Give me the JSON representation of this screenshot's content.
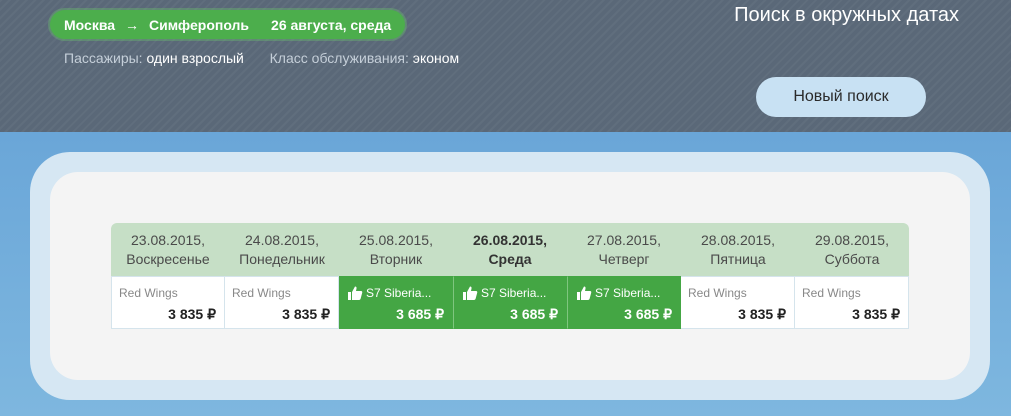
{
  "header": {
    "route_from": "Москва",
    "route_arrow": "→",
    "route_to": "Симферополь",
    "route_date": "26 августа, среда",
    "passengers_label": "Пассажиры:",
    "passengers_value": "один взрослый",
    "class_label": "Класс обслуживания:",
    "class_value": "эконом",
    "title": "Поиск в окружных датах",
    "new_search_label": "Новый поиск"
  },
  "days": [
    {
      "date": "23.08.2015,",
      "weekday": "Воскресенье",
      "current": false
    },
    {
      "date": "24.08.2015,",
      "weekday": "Понедельник",
      "current": false
    },
    {
      "date": "25.08.2015,",
      "weekday": "Вторник",
      "current": false
    },
    {
      "date": "26.08.2015,",
      "weekday": "Среда",
      "current": true
    },
    {
      "date": "27.08.2015,",
      "weekday": "Четверг",
      "current": false
    },
    {
      "date": "28.08.2015,",
      "weekday": "Пятница",
      "current": false
    },
    {
      "date": "29.08.2015,",
      "weekday": "Суббота",
      "current": false
    }
  ],
  "fares": [
    {
      "airline": "Red Wings",
      "price": "3 835 ₽",
      "best": false
    },
    {
      "airline": "Red Wings",
      "price": "3 835 ₽",
      "best": false
    },
    {
      "airline": "S7 Siberia...",
      "price": "3 685 ₽",
      "best": true,
      "icon": "thumbs-up-icon"
    },
    {
      "airline": "S7 Siberia...",
      "price": "3 685 ₽",
      "best": true,
      "icon": "thumbs-up-icon"
    },
    {
      "airline": "S7 Siberia...",
      "price": "3 685 ₽",
      "best": true,
      "icon": "thumbs-up-icon"
    },
    {
      "airline": "Red Wings",
      "price": "3 835 ₽",
      "best": false
    },
    {
      "airline": "Red Wings",
      "price": "3 835 ₽",
      "best": false
    }
  ],
  "colors": {
    "header_bg": "#5a6878",
    "accent_green": "#44a644",
    "day_header_bg": "#c6dfc6",
    "button_bg": "#c8e1f3",
    "page_bg": "#6aa6d6"
  }
}
